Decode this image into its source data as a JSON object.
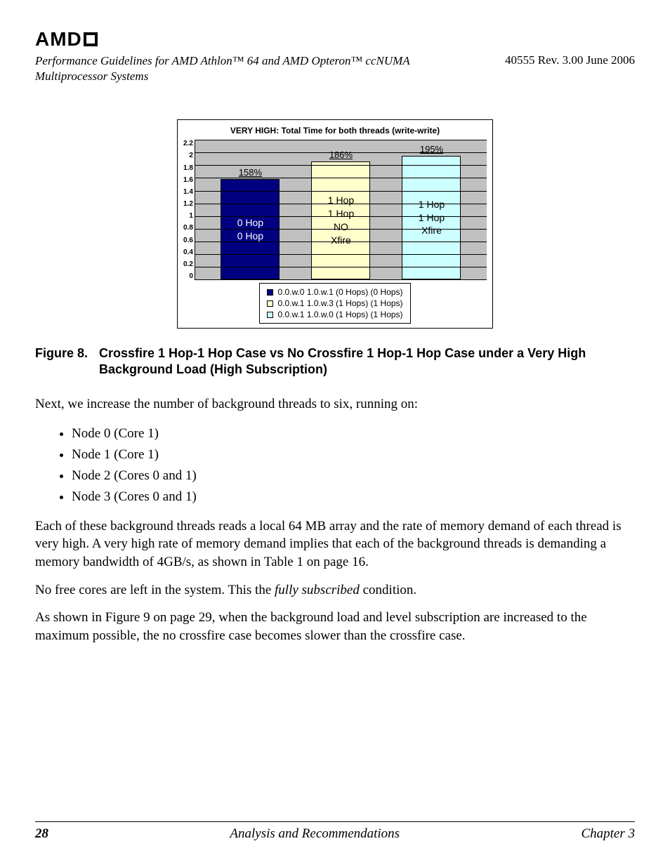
{
  "header": {
    "logo": "AMD",
    "doc_title": "Performance Guidelines for AMD Athlon™ 64 and AMD Opteron™ ccNUMA Multiprocessor Systems",
    "doc_meta": "40555   Rev. 3.00   June 2006"
  },
  "chart_data": {
    "type": "bar",
    "title": "VERY HIGH: Total Time for both threads (write-write)",
    "ylim": [
      0,
      2.2
    ],
    "yticks": [
      "2.2",
      "2",
      "1.8",
      "1.6",
      "1.4",
      "1.2",
      "1",
      "0.8",
      "0.6",
      "0.4",
      "0.2",
      "0"
    ],
    "series": [
      {
        "name": "0.0.w.0  1.0.w.1  (0 Hops)  (0 Hops)",
        "color": "#000080",
        "value": 1.58,
        "value_label": "158%",
        "bar_text": [
          "0 Hop",
          "0 Hop"
        ],
        "text_dark": false
      },
      {
        "name": "0.0.w.1  1.0.w.3  (1 Hops)  (1 Hops)",
        "color": "#ffffcc",
        "value": 1.86,
        "value_label": "186%",
        "bar_text": [
          "1 Hop",
          "1 Hop",
          "NO",
          "Xfire"
        ],
        "text_dark": true
      },
      {
        "name": "0.0.w.1  1.0.w.0  (1 Hops)  (1 Hops)",
        "color": "#ccffff",
        "value": 1.95,
        "value_label": "195%",
        "bar_text": [
          "1 Hop",
          "1 Hop",
          "Xfire"
        ],
        "text_dark": true
      }
    ]
  },
  "figure": {
    "num": "Figure 8.",
    "caption": "Crossfire 1 Hop-1 Hop Case vs No Crossfire 1 Hop-1 Hop Case under a Very High Background Load (High Subscription)"
  },
  "para1": "Next, we increase the number of background threads to six, running on:",
  "list": [
    "Node 0 (Core 1)",
    "Node 1 (Core 1)",
    "Node 2 (Cores 0 and 1)",
    "Node 3 (Cores 0 and 1)"
  ],
  "para2": "Each of these background threads reads a local 64 MB array and the rate of memory demand of each thread is very high. A very high rate of memory demand implies that each of the background threads is demanding a memory bandwidth of 4GB/s, as shown in Table 1 on page 16.",
  "para3_a": "No free cores are left in the system. This the ",
  "para3_em": "fully subscribed",
  "para3_b": " condition.",
  "para4": "As shown in Figure 9 on page 29, when the background load and level subscription are increased to the maximum possible, the no crossfire case becomes slower than the crossfire case.",
  "footer": {
    "page": "28",
    "section": "Analysis and Recommendations",
    "chapter": "Chapter 3"
  }
}
